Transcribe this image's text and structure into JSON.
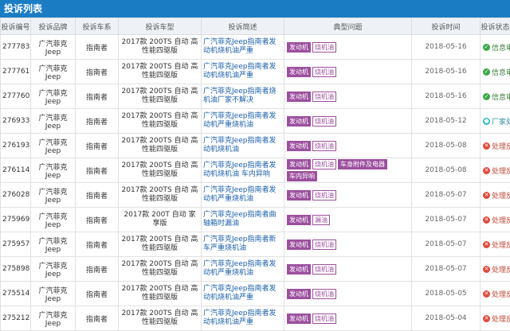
{
  "page": {
    "title": "投诉列表"
  },
  "columns": [
    "投诉编号",
    "投诉品牌",
    "投诉车系",
    "投诉车型",
    "投诉简述",
    "典型问题",
    "投诉时间",
    "投诉状态"
  ],
  "status_colors": {
    "ok": "#3aa84a",
    "fail": "#e0493c",
    "proc": "#2fb8c9"
  },
  "tag_color": "#9c4f9e",
  "rows": [
    {
      "id": "277783",
      "brand": "广汽菲克Jeep",
      "series": "指南者",
      "model": "2017款 200TS 自动 高性能四驱版",
      "brief": "广汽菲克Jeep指南者发动机烧机油严重",
      "tags": [
        {
          "text": "发动机",
          "style": "solid"
        },
        {
          "text": "烧机油",
          "style": "outline"
        }
      ],
      "date": "2018-05-16",
      "status": "信息审核",
      "status_type": "ok",
      "status_icon": "✓"
    },
    {
      "id": "277761",
      "brand": "广汽菲克Jeep",
      "series": "指南者",
      "model": "2017款 200TS 自动 高性能四驱版",
      "brief": "广汽菲克Jeep指南者发动机烧机油严重",
      "tags": [
        {
          "text": "发动机",
          "style": "solid"
        },
        {
          "text": "烧机油",
          "style": "outline"
        }
      ],
      "date": "2018-05-16",
      "status": "信息审核",
      "status_type": "ok",
      "status_icon": "✓"
    },
    {
      "id": "277760",
      "brand": "广汽菲克Jeep",
      "series": "指南者",
      "model": "2017款 200TS 自动 高性能四驱版",
      "brief": "广汽菲克Jeep指南者烧机油厂家不解决",
      "tags": [
        {
          "text": "发动机",
          "style": "solid"
        },
        {
          "text": "烧机油",
          "style": "outline"
        }
      ],
      "date": "2018-05-16",
      "status": "信息审核",
      "status_type": "ok",
      "status_icon": "✓"
    },
    {
      "id": "276933",
      "brand": "广汽菲克Jeep",
      "series": "指南者",
      "model": "2017款 200TS 自动 高性能四驱版",
      "brief": "广汽菲克Jeep指南者发动机严重烧机油",
      "tags": [
        {
          "text": "发动机",
          "style": "solid"
        },
        {
          "text": "烧机油",
          "style": "outline"
        }
      ],
      "date": "2018-05-12",
      "status": "厂家处理",
      "status_type": "proc",
      "status_icon": "●"
    },
    {
      "id": "276193",
      "brand": "广汽菲克Jeep",
      "series": "指南者",
      "model": "2017款 200TS 自动 高性能四驱版",
      "brief": "广汽菲克Jeep指南者发动机烧机油",
      "tags": [
        {
          "text": "发动机",
          "style": "solid"
        },
        {
          "text": "烧机油",
          "style": "outline"
        }
      ],
      "date": "2018-05-08",
      "status": "处理反馈",
      "status_type": "fail",
      "status_icon": "✕"
    },
    {
      "id": "276114",
      "brand": "广汽菲克Jeep",
      "series": "指南者",
      "model": "2017款 200TS 自动 高性能四驱版",
      "brief": "广汽菲克Jeep指南者发动机烧机油 车内异响",
      "tags": [
        {
          "text": "发动机",
          "style": "solid"
        },
        {
          "text": "烧机油",
          "style": "outline"
        },
        {
          "text": "车身附件及电器",
          "style": "solid"
        },
        {
          "text": "车内异响",
          "style": "solid"
        }
      ],
      "date": "2018-05-08",
      "status": "处理反馈",
      "status_type": "fail",
      "status_icon": "✕"
    },
    {
      "id": "276028",
      "brand": "广汽菲克Jeep",
      "series": "指南者",
      "model": "2017款 200TS 自动 高性能四驱版",
      "brief": "广汽菲克Jeep指南者发动机严重烧机油",
      "tags": [
        {
          "text": "发动机",
          "style": "solid"
        },
        {
          "text": "烧机油",
          "style": "outline"
        }
      ],
      "date": "2018-05-07",
      "status": "处理反馈",
      "status_type": "fail",
      "status_icon": "✕"
    },
    {
      "id": "275969",
      "brand": "广汽菲克Jeep",
      "series": "指南者",
      "model": "2017款 200T 自动 家享版",
      "brief": "广汽菲克Jeep指南者曲轴箱时漏油",
      "tags": [
        {
          "text": "发动机",
          "style": "solid"
        },
        {
          "text": "漏油",
          "style": "outline"
        }
      ],
      "date": "2018-05-07",
      "status": "处理反馈",
      "status_type": "fail",
      "status_icon": "✕"
    },
    {
      "id": "275957",
      "brand": "广汽菲克Jeep",
      "series": "指南者",
      "model": "2017款 200TS 自动 高性能四驱版",
      "brief": "广汽菲克Jeep指南者新车严重烧机油",
      "tags": [
        {
          "text": "发动机",
          "style": "solid"
        },
        {
          "text": "烧机油",
          "style": "outline"
        }
      ],
      "date": "2018-05-07",
      "status": "处理反馈",
      "status_type": "fail",
      "status_icon": "✕"
    },
    {
      "id": "275898",
      "brand": "广汽菲克Jeep",
      "series": "指南者",
      "model": "2017款 200TS 自动 高性能四驱版",
      "brief": "广汽菲克Jeep指南者发动机严重烧机油",
      "tags": [
        {
          "text": "发动机",
          "style": "solid"
        },
        {
          "text": "烧机油",
          "style": "outline"
        }
      ],
      "date": "2018-05-07",
      "status": "处理反馈",
      "status_type": "fail",
      "status_icon": "✕"
    },
    {
      "id": "275514",
      "brand": "广汽菲克Jeep",
      "series": "指南者",
      "model": "2017款 200TS 自动 高性能四驱版",
      "brief": "广汽菲克Jeep指南者发动机烧机油严重",
      "tags": [
        {
          "text": "发动机",
          "style": "solid"
        },
        {
          "text": "烧机油",
          "style": "outline"
        }
      ],
      "date": "2018-05-05",
      "status": "处理反馈",
      "status_type": "fail",
      "status_icon": "✕"
    },
    {
      "id": "275212",
      "brand": "广汽菲克Jeep",
      "series": "指南者",
      "model": "2017款 200TS 自动 高性能四驱版",
      "brief": "广汽菲克Jeep指南者发动机烧机油严重",
      "tags": [
        {
          "text": "发动机",
          "style": "solid"
        },
        {
          "text": "烧机油",
          "style": "outline"
        }
      ],
      "date": "2018-05-04",
      "status": "处理反馈",
      "status_type": "fail",
      "status_icon": "✕"
    }
  ]
}
